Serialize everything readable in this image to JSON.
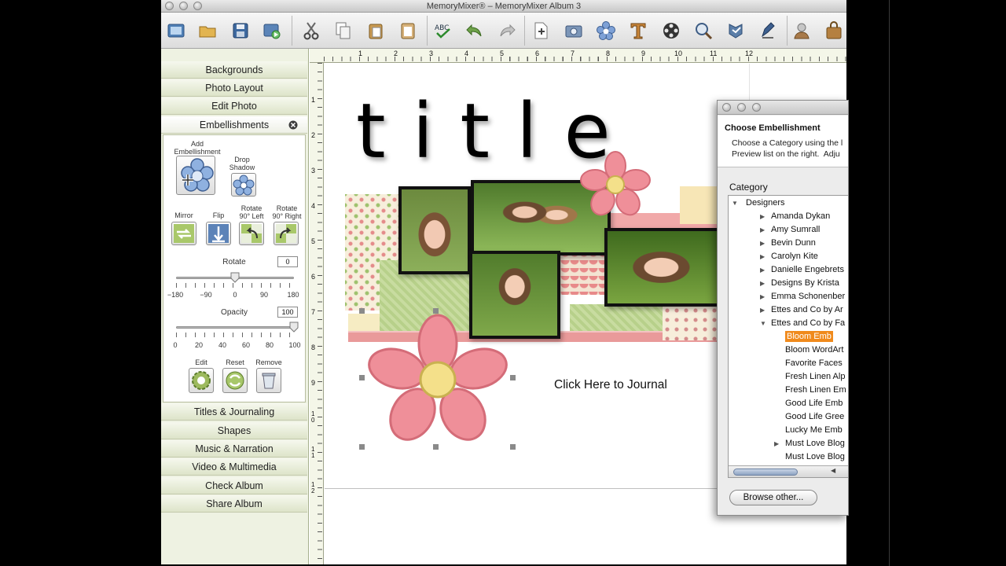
{
  "window": {
    "title": "MemoryMixer® – MemoryMixer Album 3"
  },
  "toolbar": {
    "icons": [
      "new-album-icon",
      "open-icon",
      "save-icon",
      "preview-icon",
      "cut-icon",
      "copy-icon",
      "paste-icon",
      "clipboard-icon",
      "spell-check-icon",
      "undo-icon",
      "redo-icon",
      "new-page-icon",
      "photo-icon",
      "flower-icon",
      "text-tool-icon",
      "film-icon",
      "zoom-icon",
      "stamp-icon",
      "pen-icon",
      "person-icon",
      "bag-icon"
    ]
  },
  "sidebar": {
    "categories_top": [
      "Backgrounds",
      "Photo Layout",
      "Edit Photo",
      "Embellishments"
    ],
    "categories_bottom": [
      "Titles & Journaling",
      "Shapes",
      "Music & Narration",
      "Video & Multimedia",
      "Check Album",
      "Share Album"
    ],
    "panel": {
      "add_embellishment": "Add\nEmbellishment",
      "drop_shadow": "Drop\nShadow",
      "mirror": "Mirror",
      "flip": "Flip",
      "rotate_left": "Rotate\n90° Left",
      "rotate_right": "Rotate\n90° Right",
      "rotate_label": "Rotate",
      "rotate_value": "0",
      "rotate_scale": [
        "−180",
        "−90",
        "0",
        "90",
        "180"
      ],
      "rotate_fraction": 0.5,
      "opacity_label": "Opacity",
      "opacity_value": "100",
      "opacity_scale": [
        "0",
        "20",
        "40",
        "60",
        "80",
        "100"
      ],
      "opacity_fraction": 1.0,
      "edit": "Edit",
      "reset": "Reset",
      "remove": "Remove"
    }
  },
  "canvas": {
    "ruler_h": [
      "1",
      "2",
      "3",
      "4",
      "5",
      "6",
      "7",
      "8",
      "9",
      "10",
      "11",
      "12"
    ],
    "ruler_v": [
      "1",
      "2",
      "3",
      "4",
      "5",
      "6",
      "7",
      "8",
      "9",
      "1\n0",
      "1\n1",
      "1\n2"
    ],
    "title_text": "title",
    "journal_text": "Click Here to Journal"
  },
  "dialog": {
    "heading": "Choose Embellishment",
    "description": "Choose a Category using the l\nPreview list on the right.  Adju",
    "category_label": "Category",
    "root": "Designers",
    "tree": [
      {
        "label": "Amanda Dykan",
        "expandable": true
      },
      {
        "label": "Amy Sumrall",
        "expandable": true
      },
      {
        "label": "Bevin Dunn",
        "expandable": true
      },
      {
        "label": "Carolyn Kite",
        "expandable": true
      },
      {
        "label": "Danielle Engebrets",
        "expandable": true
      },
      {
        "label": "Designs By Krista",
        "expandable": true
      },
      {
        "label": "Emma Schonenber",
        "expandable": true
      },
      {
        "label": "Ettes and Co by Ar",
        "expandable": true
      },
      {
        "label": "Ettes and Co by Fa",
        "expanded": true
      }
    ],
    "children": [
      {
        "label": "Bloom Emb",
        "selected": true
      },
      {
        "label": "Bloom WordArt"
      },
      {
        "label": "Favorite Faces"
      },
      {
        "label": "Fresh Linen Alp"
      },
      {
        "label": "Fresh Linen Em"
      },
      {
        "label": "Good Life Emb"
      },
      {
        "label": "Good Life Gree"
      },
      {
        "label": "Lucky Me Emb"
      },
      {
        "label": "Must Love Blog",
        "expandable": true
      },
      {
        "label": "Must Love Blog"
      }
    ],
    "browse_button": "Browse other...",
    "selection_color": "#f08a1c"
  }
}
